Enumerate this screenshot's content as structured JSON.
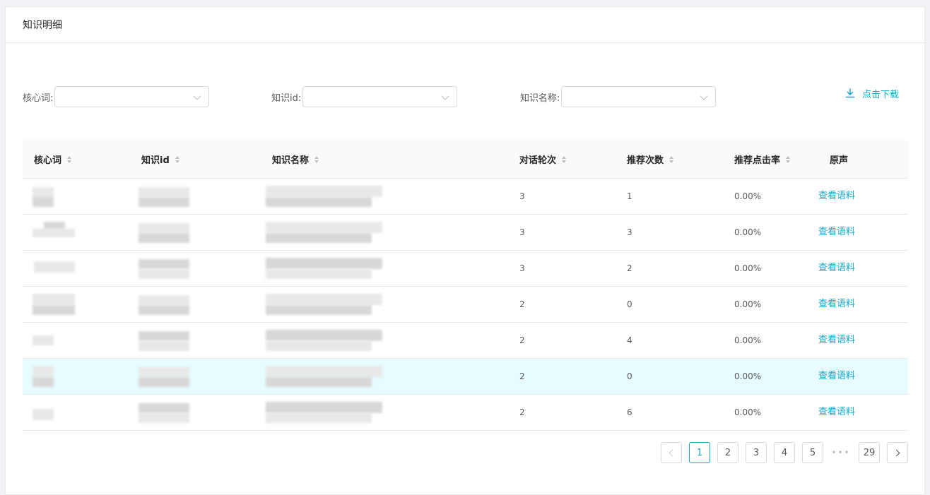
{
  "panel": {
    "title": "知识明细"
  },
  "filters": {
    "core_word_label": "核心词:",
    "knowledge_id_label": "知识id:",
    "knowledge_name_label": "知识名称:",
    "core_word_value": "",
    "knowledge_id_value": "",
    "knowledge_name_value": "",
    "download_label": "点击下载"
  },
  "table": {
    "columns": [
      "核心词",
      "知识id",
      "知识名称",
      "对话轮次",
      "推荐次数",
      "推荐点击率",
      "原声"
    ],
    "rows": [
      {
        "dialogue_turns": "3",
        "recommend_count": "1",
        "click_rate": "0.00%",
        "action": "查看语料"
      },
      {
        "dialogue_turns": "3",
        "recommend_count": "3",
        "click_rate": "0.00%",
        "action": "查看语料"
      },
      {
        "dialogue_turns": "3",
        "recommend_count": "2",
        "click_rate": "0.00%",
        "action": "查看语料"
      },
      {
        "dialogue_turns": "2",
        "recommend_count": "0",
        "click_rate": "0.00%",
        "action": "查看语料"
      },
      {
        "dialogue_turns": "2",
        "recommend_count": "4",
        "click_rate": "0.00%",
        "action": "查看语料"
      },
      {
        "dialogue_turns": "2",
        "recommend_count": "0",
        "click_rate": "0.00%",
        "action": "查看语料"
      },
      {
        "dialogue_turns": "2",
        "recommend_count": "6",
        "click_rate": "0.00%",
        "action": "查看语料"
      }
    ],
    "highlighted_row": 5
  },
  "pagination": {
    "pages": [
      "1",
      "2",
      "3",
      "4",
      "5"
    ],
    "ellipsis": "•••",
    "last_page": "29",
    "current": "1"
  },
  "colors": {
    "accent": "#13a8c8",
    "highlight_row": "#e6fcff"
  }
}
